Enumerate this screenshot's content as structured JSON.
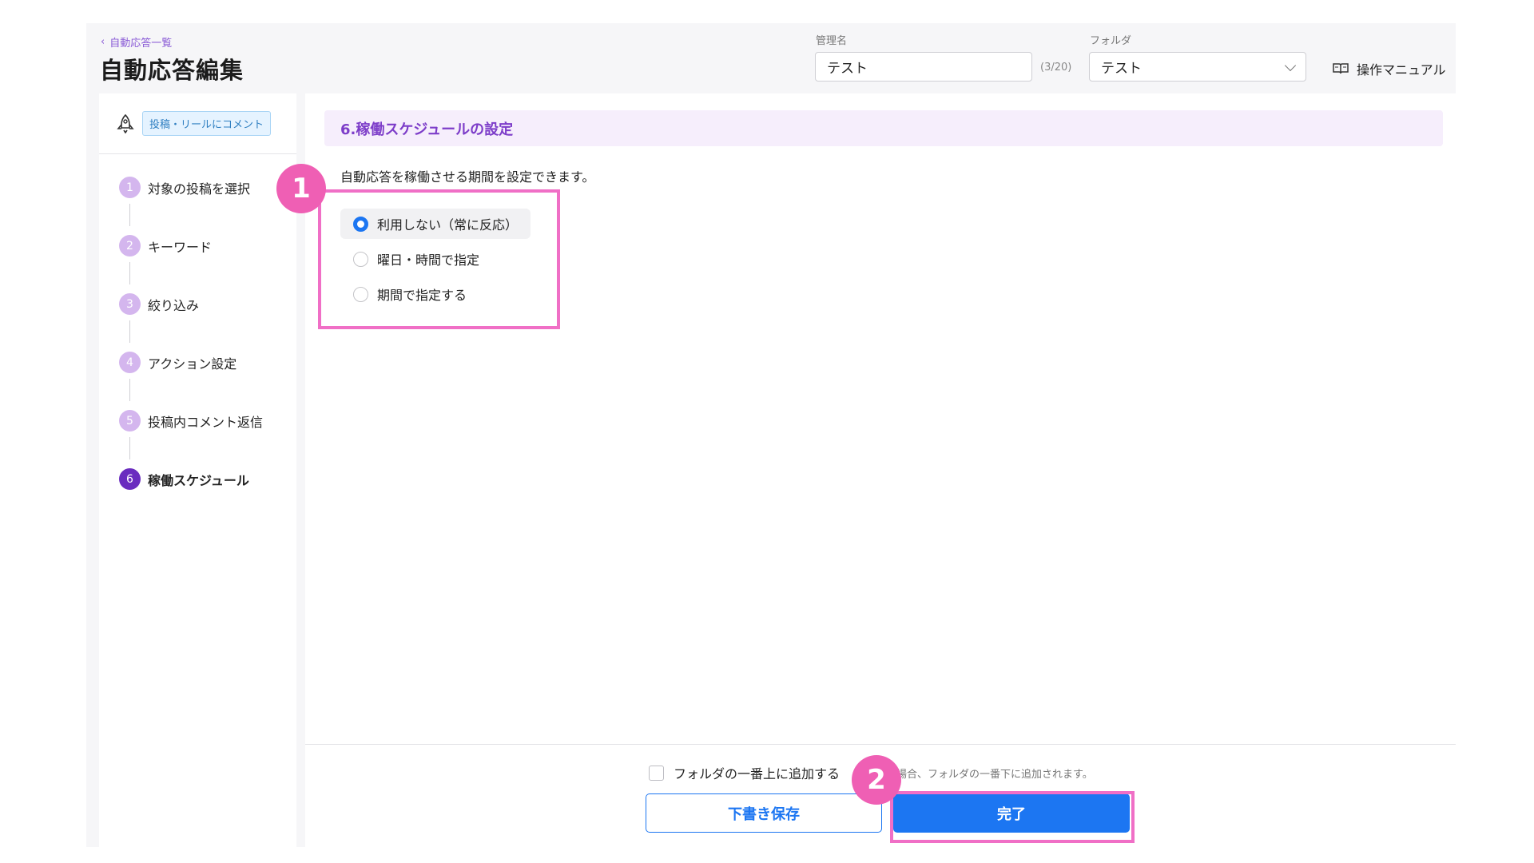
{
  "header": {
    "back_label": "自動応答一覧",
    "title": "自動応答編集",
    "name_field": {
      "label": "管理名",
      "value": "テスト",
      "counter": "(3/20)"
    },
    "folder_field": {
      "label": "フォルダ",
      "value": "テスト"
    },
    "manual_label": "操作マニュアル"
  },
  "sidebar": {
    "trigger_badge": "投稿・リールにコメント",
    "steps": [
      {
        "num": "1",
        "label": "対象の投稿を選択"
      },
      {
        "num": "2",
        "label": "キーワード"
      },
      {
        "num": "3",
        "label": "絞り込み"
      },
      {
        "num": "4",
        "label": "アクション設定"
      },
      {
        "num": "5",
        "label": "投稿内コメント返信"
      },
      {
        "num": "6",
        "label": "稼働スケジュール"
      }
    ]
  },
  "main": {
    "section_title": "6.稼働スケジュールの設定",
    "description": "自動応答を稼働させる期間を設定できます。",
    "options": [
      {
        "label": "利用しない（常に反応）",
        "selected": true
      },
      {
        "label": "曜日・時間で指定",
        "selected": false
      },
      {
        "label": "期間で指定する",
        "selected": false
      }
    ],
    "checkbox_label": "フォルダの一番上に追加する",
    "note": "場合、フォルダの一番下に追加されます。",
    "draft_button": "下書き保存",
    "done_button": "完了"
  },
  "annotations": {
    "marker1": "1",
    "marker2": "2",
    "color": "#ef5fb4"
  },
  "colors": {
    "accent_purple": "#7d3dc9",
    "primary_blue": "#1c76f2"
  }
}
